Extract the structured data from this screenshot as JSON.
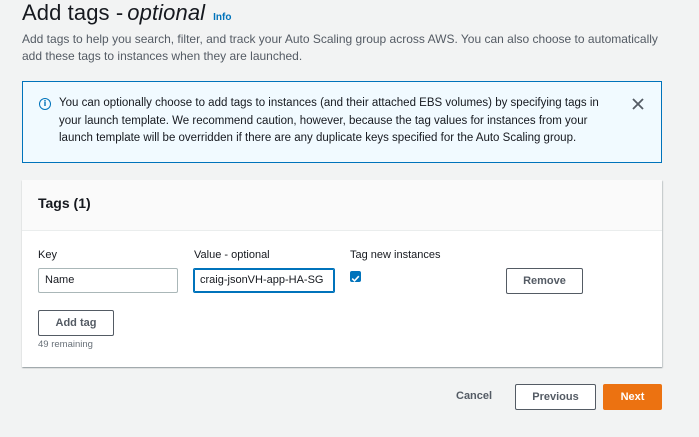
{
  "page": {
    "title": "Add tags -",
    "title_emphasis": "optional",
    "info_label": "Info",
    "description": "Add tags to help you search, filter, and track your Auto Scaling group across AWS. You can also choose to automatically add these tags to instances when they are launched."
  },
  "alert": {
    "icon": "info-icon",
    "text": "You can optionally choose to add tags to instances (and their attached EBS volumes) by specifying tags in your launch template. We recommend caution, however, because the tag values for instances from your launch template will be overridden if there are any duplicate keys specified for the Auto Scaling group."
  },
  "tags": {
    "title": "Tags (1)",
    "key_label": "Key",
    "value_label": "Value - optional",
    "tag_new_label": "Tag new instances",
    "rows": [
      {
        "key": "Name",
        "value": "craig-jsonVH-app-HA-SG",
        "tag_new_instances": true
      }
    ],
    "remove_label": "Remove",
    "add_tag_label": "Add tag",
    "remaining": "49 remaining"
  },
  "footer": {
    "cancel_label": "Cancel",
    "previous_label": "Previous",
    "next_label": "Next"
  },
  "colors": {
    "accent": "#0073bb",
    "primary_button": "#ec7211",
    "background": "#f2f3f3"
  }
}
